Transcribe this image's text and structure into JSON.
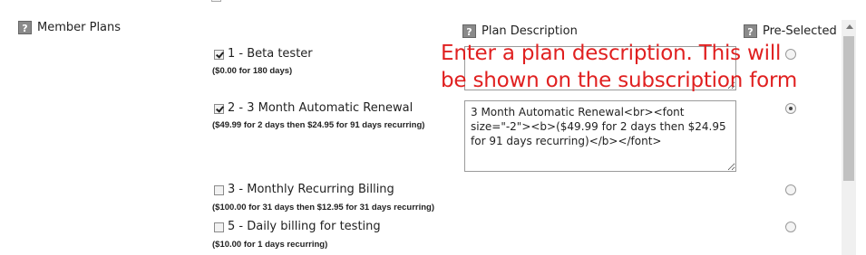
{
  "section": {
    "help_glyph": "?",
    "member_plans_label": "Member Plans"
  },
  "columns": {
    "plan_description": "Plan Description",
    "pre_selected": "Pre-Selected"
  },
  "plans": [
    {
      "label": "1 - Beta tester",
      "detail": "($0.00 for 180 days)",
      "checked": true,
      "preselected": false
    },
    {
      "label": "2 - 3 Month Automatic Renewal",
      "detail": "($49.99 for 2 days then $24.95 for 91 days recurring)",
      "checked": true,
      "preselected": true
    },
    {
      "label": "3 - Monthly Recurring Billing",
      "detail": "($100.00 for 31 days then $12.95 for 31 days recurring)",
      "checked": false,
      "preselected": false
    },
    {
      "label": "5 - Daily billing for testing",
      "detail": "($10.00 for 1 days recurring)",
      "checked": false,
      "preselected": false
    }
  ],
  "descriptions": {
    "plan1": "",
    "plan2": "3 Month Automatic Renewal<br><font size=\"-2\"><b>($49.99 for 2 days then $24.95 for 91 days recurring)</b></font>"
  },
  "annotation": {
    "line1": "Enter a plan description. This will",
    "line2": "be shown on the subscription form",
    "color": "#e02020"
  }
}
